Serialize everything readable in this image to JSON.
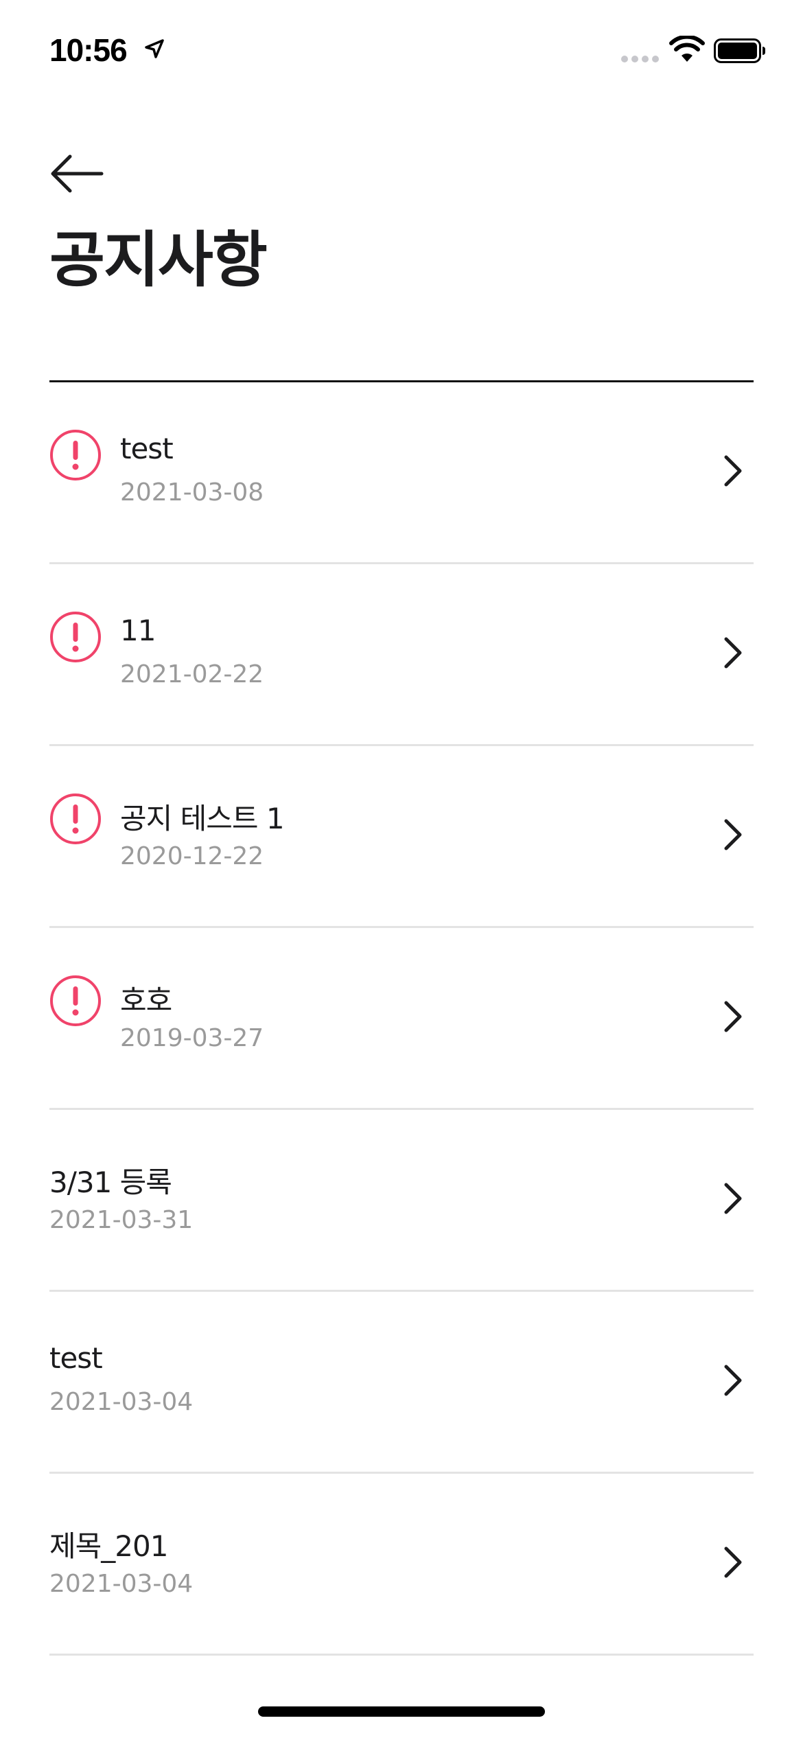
{
  "status_bar": {
    "time": "10:56"
  },
  "header": {
    "title": "공지사항"
  },
  "notices": [
    {
      "title": "test",
      "date": "2021-03-08",
      "important": true
    },
    {
      "title": "11",
      "date": "2021-02-22",
      "important": true
    },
    {
      "title": "공지 테스트 1",
      "date": "2020-12-22",
      "important": true
    },
    {
      "title": "호호",
      "date": "2019-03-27",
      "important": true
    },
    {
      "title": "3/31 등록",
      "date": "2021-03-31",
      "important": false
    },
    {
      "title": "test",
      "date": "2021-03-04",
      "important": false
    },
    {
      "title": "제목_201",
      "date": "2021-03-04",
      "important": false
    }
  ],
  "colors": {
    "alert": "#f0436a",
    "divider": "#e3e3e3",
    "date_text": "#9a9a9a",
    "title_text": "#1c1c1e"
  }
}
